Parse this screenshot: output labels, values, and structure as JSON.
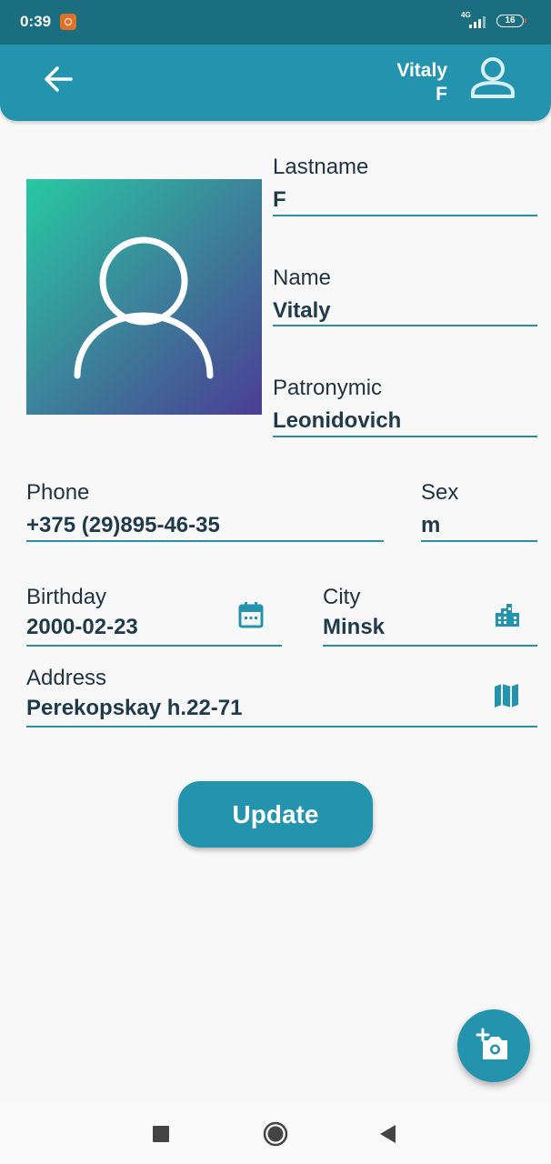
{
  "status_bar": {
    "time": "0:39",
    "network": "4G",
    "battery": "16"
  },
  "app_bar": {
    "user_first_name": "Vitaly",
    "user_last_initial": "F",
    "accent_color": "#2493ad"
  },
  "profile": {
    "lastname": {
      "label": "Lastname",
      "value": "F"
    },
    "name": {
      "label": "Name",
      "value": "Vitaly"
    },
    "patronymic": {
      "label": "Patronymic",
      "value": "Leonidovich"
    },
    "phone": {
      "label": "Phone",
      "value": "+375 (29)895-46-35"
    },
    "sex": {
      "label": "Sex",
      "value": "m"
    },
    "birthday": {
      "label": "Birthday",
      "value": "2000-02-23",
      "icon": "calendar-icon"
    },
    "city": {
      "label": "City",
      "value": "Minsk",
      "icon": "city-icon"
    },
    "address": {
      "label": "Address",
      "value": "Perekopskay h.22-71",
      "icon": "map-icon"
    }
  },
  "actions": {
    "update_label": "Update",
    "photo_fab_icon": "add-photo-icon"
  }
}
